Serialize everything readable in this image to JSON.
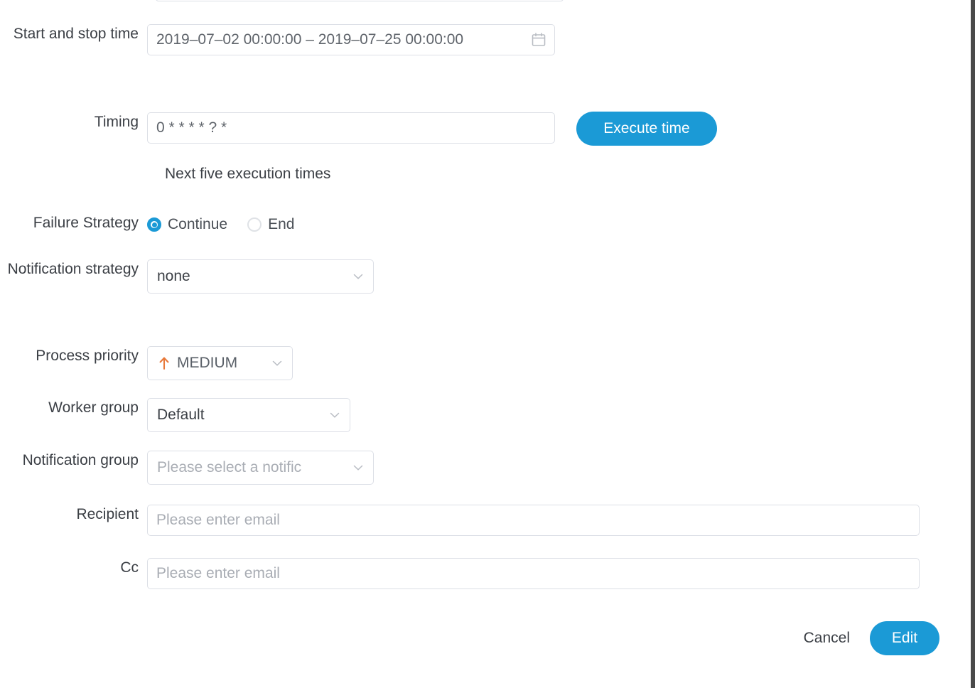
{
  "dialog": {
    "accent_color": "#1b9ad6",
    "priority_arrow_color": "#e8793a",
    "label_color": "#3b3f45",
    "placeholder_color": "#a9adb4"
  },
  "clipped_row": {
    "label": "",
    "value": ""
  },
  "fields": {
    "start_stop_time": {
      "label": "Start and stop time",
      "value": "2019–07–02 00:00:00 – 2019–07–25 00:00:00",
      "icon": "calendar-icon"
    },
    "timing": {
      "label": "Timing",
      "value": "0 * * * * ? *",
      "button_label": "Execute time",
      "helper_text": "Next five execution times"
    },
    "failure_strategy": {
      "label": "Failure Strategy",
      "options": [
        {
          "label": "Continue",
          "selected": true
        },
        {
          "label": "End",
          "selected": false
        }
      ]
    },
    "notification_strategy": {
      "label": "Notification strategy",
      "value": "none"
    },
    "process_priority": {
      "label": "Process priority",
      "value": "MEDIUM",
      "icon": "arrow-up-icon"
    },
    "worker_group": {
      "label": "Worker group",
      "value": "Default"
    },
    "notification_group": {
      "label": "Notification group",
      "placeholder": "Please select a notific"
    },
    "recipient": {
      "label": "Recipient",
      "placeholder": "Please enter email",
      "value": ""
    },
    "cc": {
      "label": "Cc",
      "placeholder": "Please enter email",
      "value": ""
    }
  },
  "footer": {
    "cancel_label": "Cancel",
    "submit_label": "Edit"
  }
}
